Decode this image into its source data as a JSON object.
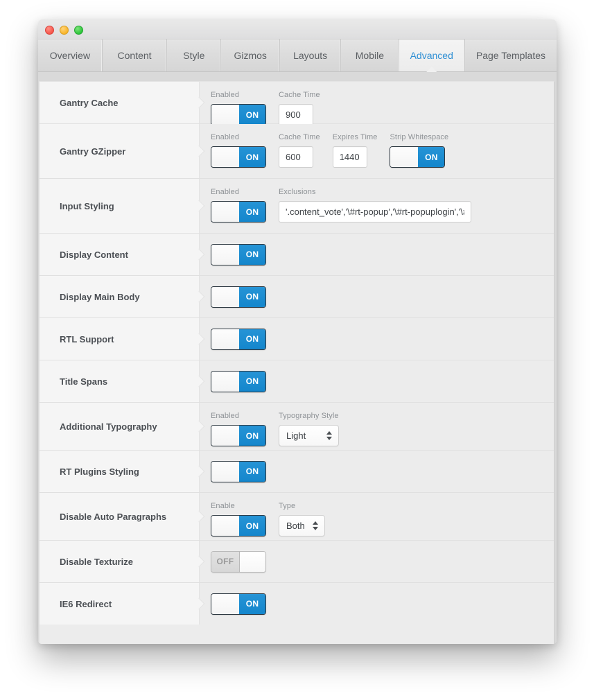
{
  "window": {
    "traffic_lights": [
      "close",
      "minimize",
      "maximize"
    ],
    "colors": {
      "accent_blue": "#1486cc",
      "tab_active_text": "#2e8fd4",
      "label_text": "#4b4f54",
      "field_label": "#8e9296",
      "panel_bg": "#ececec",
      "row_label_bg": "#f5f5f5",
      "toggle_off_text": "#9a9a9a"
    }
  },
  "tabs": [
    {
      "label": "Overview",
      "active": false
    },
    {
      "label": "Content",
      "active": false
    },
    {
      "label": "Style",
      "active": false
    },
    {
      "label": "Gizmos",
      "active": false
    },
    {
      "label": "Layouts",
      "active": false
    },
    {
      "label": "Mobile",
      "active": false
    },
    {
      "label": "Advanced",
      "active": true
    },
    {
      "label": "Page Templates",
      "active": false
    }
  ],
  "rows": [
    {
      "label": "Gantry Cache",
      "fields": [
        {
          "kind": "toggle",
          "label": "Enabled",
          "state": "ON"
        },
        {
          "kind": "text",
          "label": "Cache Time",
          "value": "900",
          "size": "small"
        }
      ]
    },
    {
      "label": "Gantry GZipper",
      "fields": [
        {
          "kind": "toggle",
          "label": "Enabled",
          "state": "ON"
        },
        {
          "kind": "text",
          "label": "Cache Time",
          "value": "600",
          "size": "small"
        },
        {
          "kind": "text",
          "label": "Expires Time",
          "value": "1440",
          "size": "small"
        },
        {
          "kind": "toggle",
          "label": "Strip Whitespace",
          "state": "ON"
        }
      ]
    },
    {
      "label": "Input Styling",
      "fields": [
        {
          "kind": "toggle",
          "label": "Enabled",
          "state": "ON"
        },
        {
          "kind": "text",
          "label": "Exclusions",
          "value": "'.content_vote','\\#rt-popup','\\#rt-popuplogin','\\#send",
          "size": "wide"
        }
      ]
    },
    {
      "label": "Display Content",
      "fields": [
        {
          "kind": "toggle",
          "label": "",
          "state": "ON"
        }
      ]
    },
    {
      "label": "Display Main Body",
      "fields": [
        {
          "kind": "toggle",
          "label": "",
          "state": "ON"
        }
      ]
    },
    {
      "label": "RTL Support",
      "fields": [
        {
          "kind": "toggle",
          "label": "",
          "state": "ON"
        }
      ]
    },
    {
      "label": "Title Spans",
      "fields": [
        {
          "kind": "toggle",
          "label": "",
          "state": "ON"
        }
      ]
    },
    {
      "label": "Additional Typography",
      "fields": [
        {
          "kind": "toggle",
          "label": "Enabled",
          "state": "ON"
        },
        {
          "kind": "select",
          "label": "Typography Style",
          "value": "Light"
        }
      ]
    },
    {
      "label": "RT Plugins Styling",
      "fields": [
        {
          "kind": "toggle",
          "label": "",
          "state": "ON"
        }
      ]
    },
    {
      "label": "Disable Auto Paragraphs",
      "fields": [
        {
          "kind": "toggle",
          "label": "Enable",
          "state": "ON"
        },
        {
          "kind": "select",
          "label": "Type",
          "value": "Both"
        }
      ]
    },
    {
      "label": "Disable Texturize",
      "fields": [
        {
          "kind": "toggle",
          "label": "",
          "state": "OFF"
        }
      ]
    },
    {
      "label": "IE6 Redirect",
      "fields": [
        {
          "kind": "toggle",
          "label": "",
          "state": "ON"
        }
      ]
    }
  ]
}
